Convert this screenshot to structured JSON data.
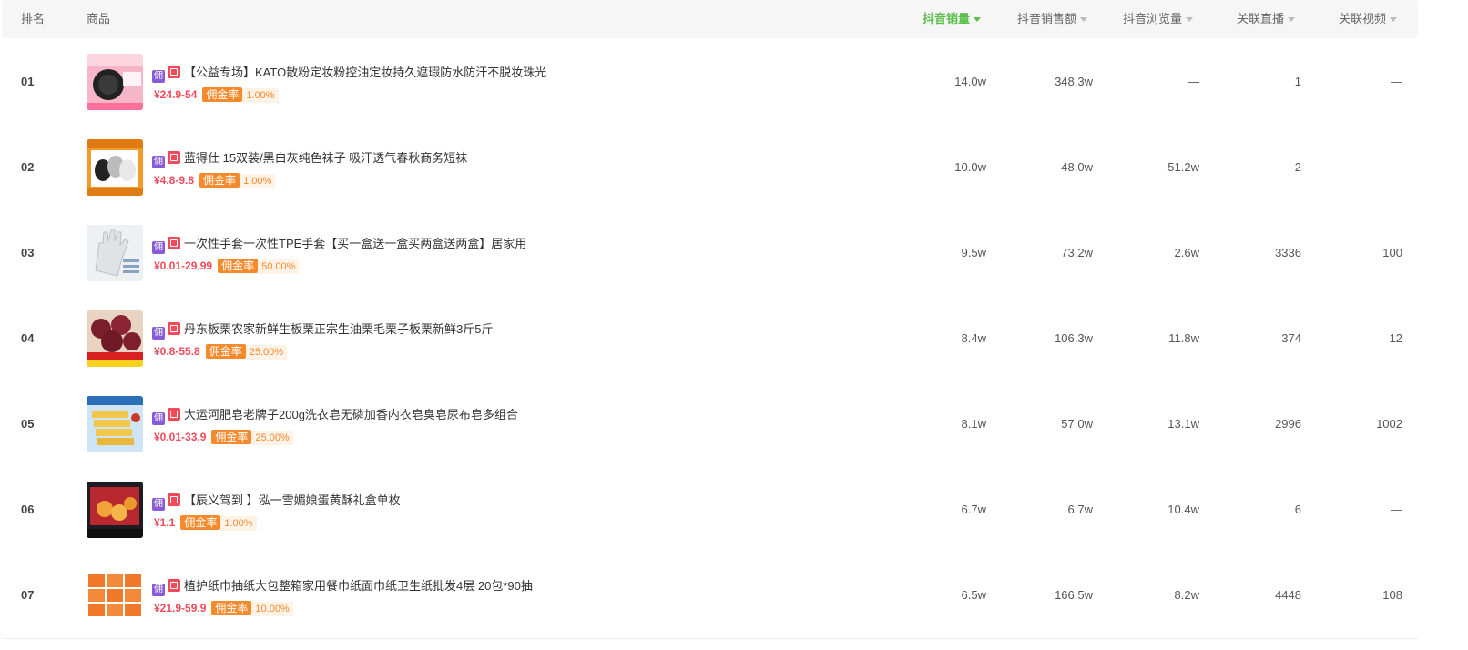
{
  "header": {
    "rank": "排名",
    "product": "商品",
    "sales": "抖音销量",
    "revenue": "抖音销售额",
    "views": "抖音浏览量",
    "live": "关联直播",
    "video": "关联视频"
  },
  "colors": {
    "active_sort": "#5ac04a",
    "price": "#f24a5a",
    "commission": "#f58a2c",
    "yong_tag": "#8a5bd6"
  },
  "tags": {
    "yong": "佣",
    "commission_label": "佣金率"
  },
  "rows": [
    {
      "rank": "01",
      "title": "【公益专场】KATO散粉定妆粉控油定妆持久遮瑕防水防汗不脱妆珠光",
      "price": "¥24.9-54",
      "rate": "1.00%",
      "sales": "14.0w",
      "revenue": "348.3w",
      "views": "—",
      "live": "1",
      "video": "—",
      "thumb": "cosmetic-powder"
    },
    {
      "rank": "02",
      "title": "蓝得仕 15双装/黑白灰纯色袜子 吸汗透气春秋商务短袜",
      "price": "¥4.8-9.8",
      "rate": "1.00%",
      "sales": "10.0w",
      "revenue": "48.0w",
      "views": "51.2w",
      "live": "2",
      "video": "—",
      "thumb": "socks"
    },
    {
      "rank": "03",
      "title": "一次性手套一次性TPE手套【买一盒送一盒买两盒送两盒】居家用",
      "price": "¥0.01-29.99",
      "rate": "50.00%",
      "sales": "9.5w",
      "revenue": "73.2w",
      "views": "2.6w",
      "live": "3336",
      "video": "100",
      "thumb": "gloves"
    },
    {
      "rank": "04",
      "title": "丹东板栗农家新鲜生板栗正宗生油栗毛栗子板栗新鲜3斤5斤",
      "price": "¥0.8-55.8",
      "rate": "25.00%",
      "sales": "8.4w",
      "revenue": "106.3w",
      "views": "11.8w",
      "live": "374",
      "video": "12",
      "thumb": "chestnuts"
    },
    {
      "rank": "05",
      "title": "大运河肥皂老牌子200g洗衣皂无磷加香内衣皂臭皂尿布皂多组合",
      "price": "¥0.01-33.9",
      "rate": "25.00%",
      "sales": "8.1w",
      "revenue": "57.0w",
      "views": "13.1w",
      "live": "2996",
      "video": "1002",
      "thumb": "soap"
    },
    {
      "rank": "06",
      "title": "【辰义驾到 】泓一雪媚娘蛋黄酥礼盒单枚",
      "price": "¥1.1",
      "rate": "1.00%",
      "sales": "6.7w",
      "revenue": "6.7w",
      "views": "10.4w",
      "live": "6",
      "video": "—",
      "thumb": "pastry"
    },
    {
      "rank": "07",
      "title": "植护纸巾抽纸大包整箱家用餐巾纸面巾纸卫生纸批发4层 20包*90抽",
      "price": "¥21.9-59.9",
      "rate": "10.00%",
      "sales": "6.5w",
      "revenue": "166.5w",
      "views": "8.2w",
      "live": "4448",
      "video": "108",
      "thumb": "tissues"
    }
  ]
}
